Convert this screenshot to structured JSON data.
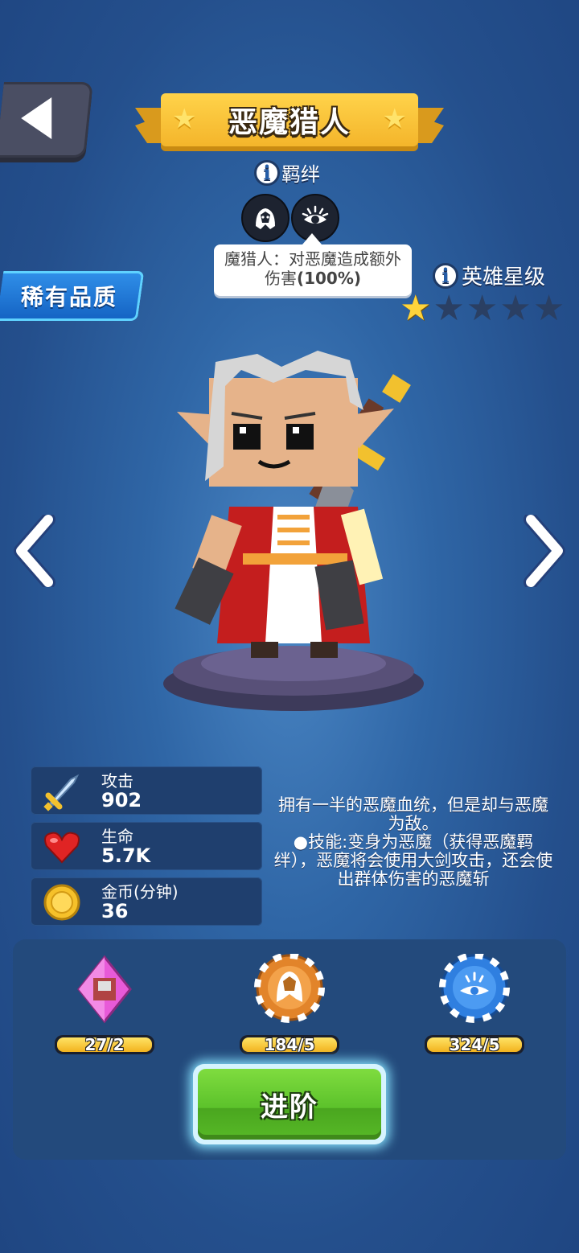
{
  "header": {
    "title": "恶魔猎人"
  },
  "bond": {
    "label": "羁绊",
    "tooltip_text": "魔猎人：对恶魔造成额外伤害",
    "tooltip_value": "(100%)"
  },
  "rarity": {
    "label": "稀有品质"
  },
  "star_level": {
    "label": "英雄星级",
    "filled": 1,
    "total": 5
  },
  "stats": [
    {
      "label": "攻击",
      "value": "902",
      "icon": "sword-icon"
    },
    {
      "label": "生命",
      "value": "5.7K",
      "icon": "heart-icon"
    },
    {
      "label": "金币(分钟)",
      "value": "36",
      "icon": "gold-coin-icon"
    }
  ],
  "description": {
    "line1": "拥有一半的恶魔血统，但是却与恶魔为敌。",
    "line2": "●技能:变身为恶魔（获得恶魔羁绊），恶魔将会使用大剑攻击，还会使出群体伤害的恶魔斩"
  },
  "resources": [
    {
      "icon": "hero-shard-icon",
      "count": "27/2"
    },
    {
      "icon": "orange-bond-token-icon",
      "count": "184/5"
    },
    {
      "icon": "blue-bond-token-icon",
      "count": "324/5"
    }
  ],
  "actions": {
    "advance_label": "进阶"
  },
  "colors": {
    "accent_gold": "#f4b52b",
    "button_green": "#5cc22b",
    "rarity_blue": "#1564c4"
  }
}
